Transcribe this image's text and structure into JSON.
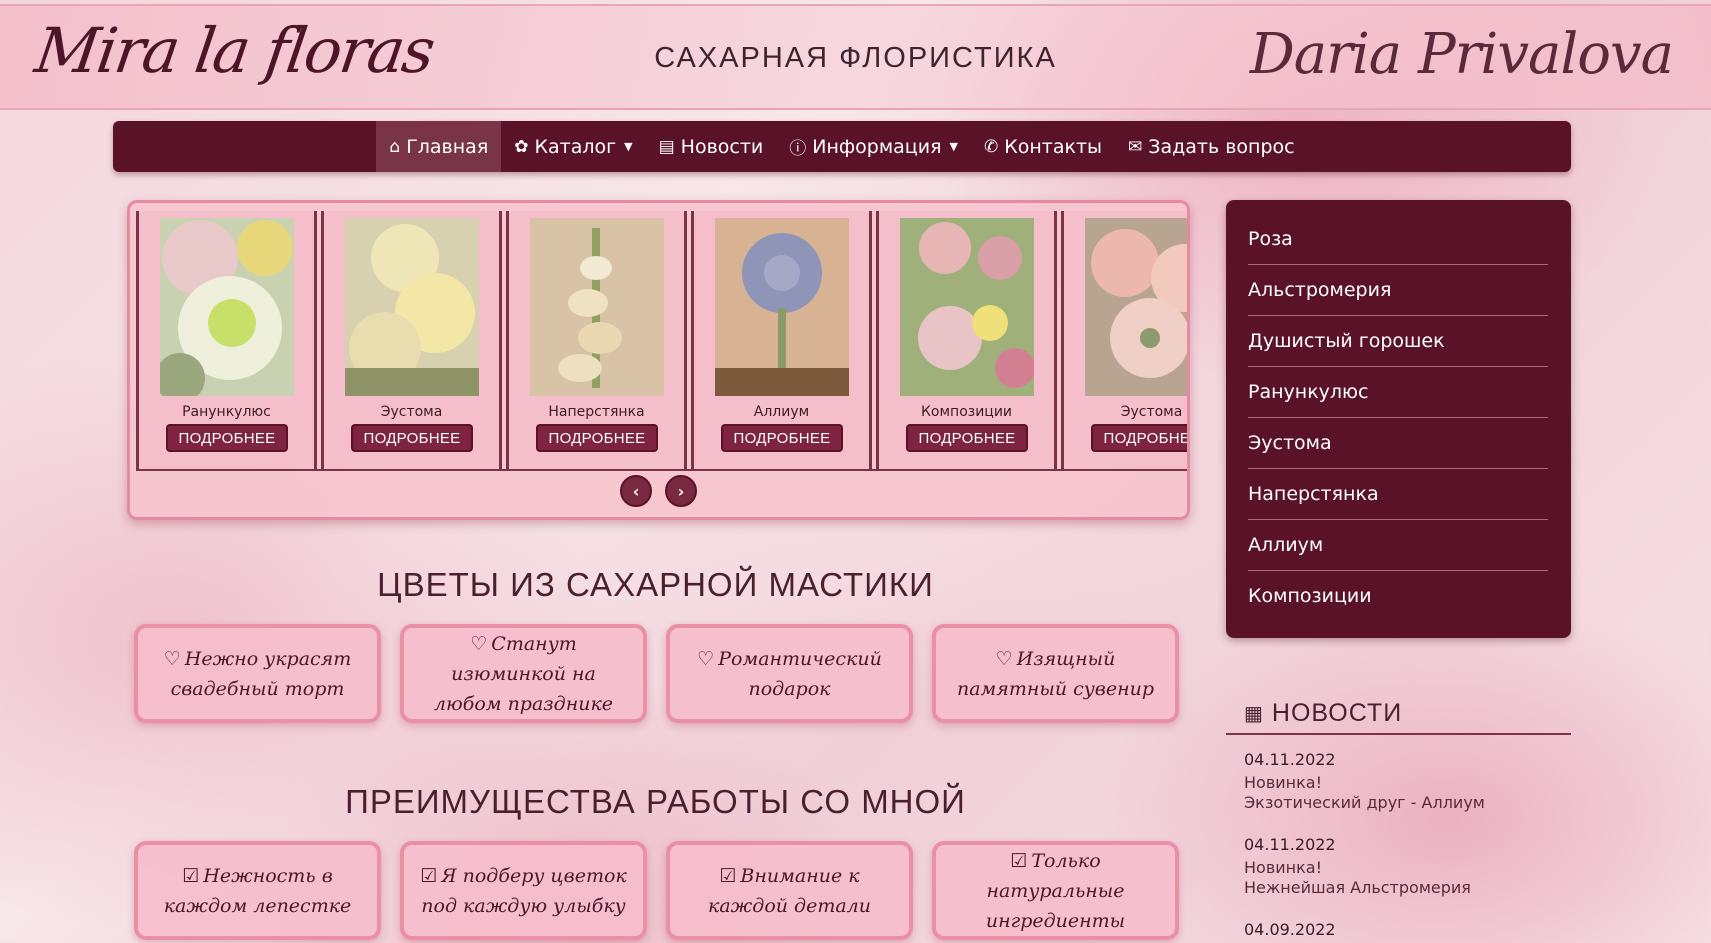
{
  "header": {
    "logo_left": "Mira la floras",
    "title": "САХАРНАЯ ФЛОРИСТИКА",
    "logo_right": "Daria Privalova"
  },
  "nav": {
    "items": [
      {
        "label": "Главная",
        "icon": "home-icon",
        "glyph": "⌂"
      },
      {
        "label": "Каталог",
        "icon": "flower-icon",
        "glyph": "✿",
        "caret": "▼"
      },
      {
        "label": "Новости",
        "icon": "document-icon",
        "glyph": "▤"
      },
      {
        "label": "Информация",
        "icon": "info-icon",
        "glyph": "ⓘ",
        "caret": "▼"
      },
      {
        "label": "Контакты",
        "icon": "phone-icon",
        "glyph": "✆"
      },
      {
        "label": "Задать вопрос",
        "icon": "envelope-icon",
        "glyph": "✉"
      }
    ]
  },
  "slider": {
    "slides": [
      {
        "caption": "Ранункулюс",
        "button": "ПОДРОБНЕЕ"
      },
      {
        "caption": "Эустома",
        "button": "ПОДРОБНЕЕ"
      },
      {
        "caption": "Наперстянка",
        "button": "ПОДРОБНЕЕ"
      },
      {
        "caption": "Аллиум",
        "button": "ПОДРОБНЕЕ"
      },
      {
        "caption": "Композиции",
        "button": "ПОДРОБНЕЕ"
      },
      {
        "caption": "Эустома",
        "button": "ПОДРОБНЕЕ"
      }
    ],
    "prev": "‹",
    "next": "›"
  },
  "section1": {
    "title": "ЦВЕТЫ ИЗ САХАРНОЙ МАСТИКИ",
    "icon_glyph": "♡",
    "cards": [
      "Нежно украсят свадебный торт",
      "Станут изюминкой на любом празднике",
      "Романтический подарок",
      "Изящный памятный сувенир"
    ]
  },
  "section2": {
    "title": "ПРЕИМУЩЕСТВА РАБОТЫ СО МНОЙ",
    "icon_glyph": "☑",
    "cards": [
      "Нежность в каждом лепестке",
      "Я подберу цветок под каждую улыбку",
      "Внимание к каждой детали",
      "Только натуральные ингредиенты"
    ]
  },
  "sidebar": {
    "items": [
      "Роза",
      "Альстромерия",
      "Душистый горошек",
      "Ранункулюс",
      "Эустома",
      "Наперстянка",
      "Аллиум",
      "Композиции"
    ]
  },
  "news": {
    "title": "НОВОСТИ",
    "icon_glyph": "▦",
    "items": [
      {
        "date": "04.11.2022",
        "line1": "Новинка!",
        "line2": "Экзотический друг - Аллиум"
      },
      {
        "date": "04.11.2022",
        "line1": "Новинка!",
        "line2": "Нежнейшая Альстромерия"
      },
      {
        "date": "04.09.2022",
        "line1": "",
        "line2": ""
      }
    ]
  }
}
